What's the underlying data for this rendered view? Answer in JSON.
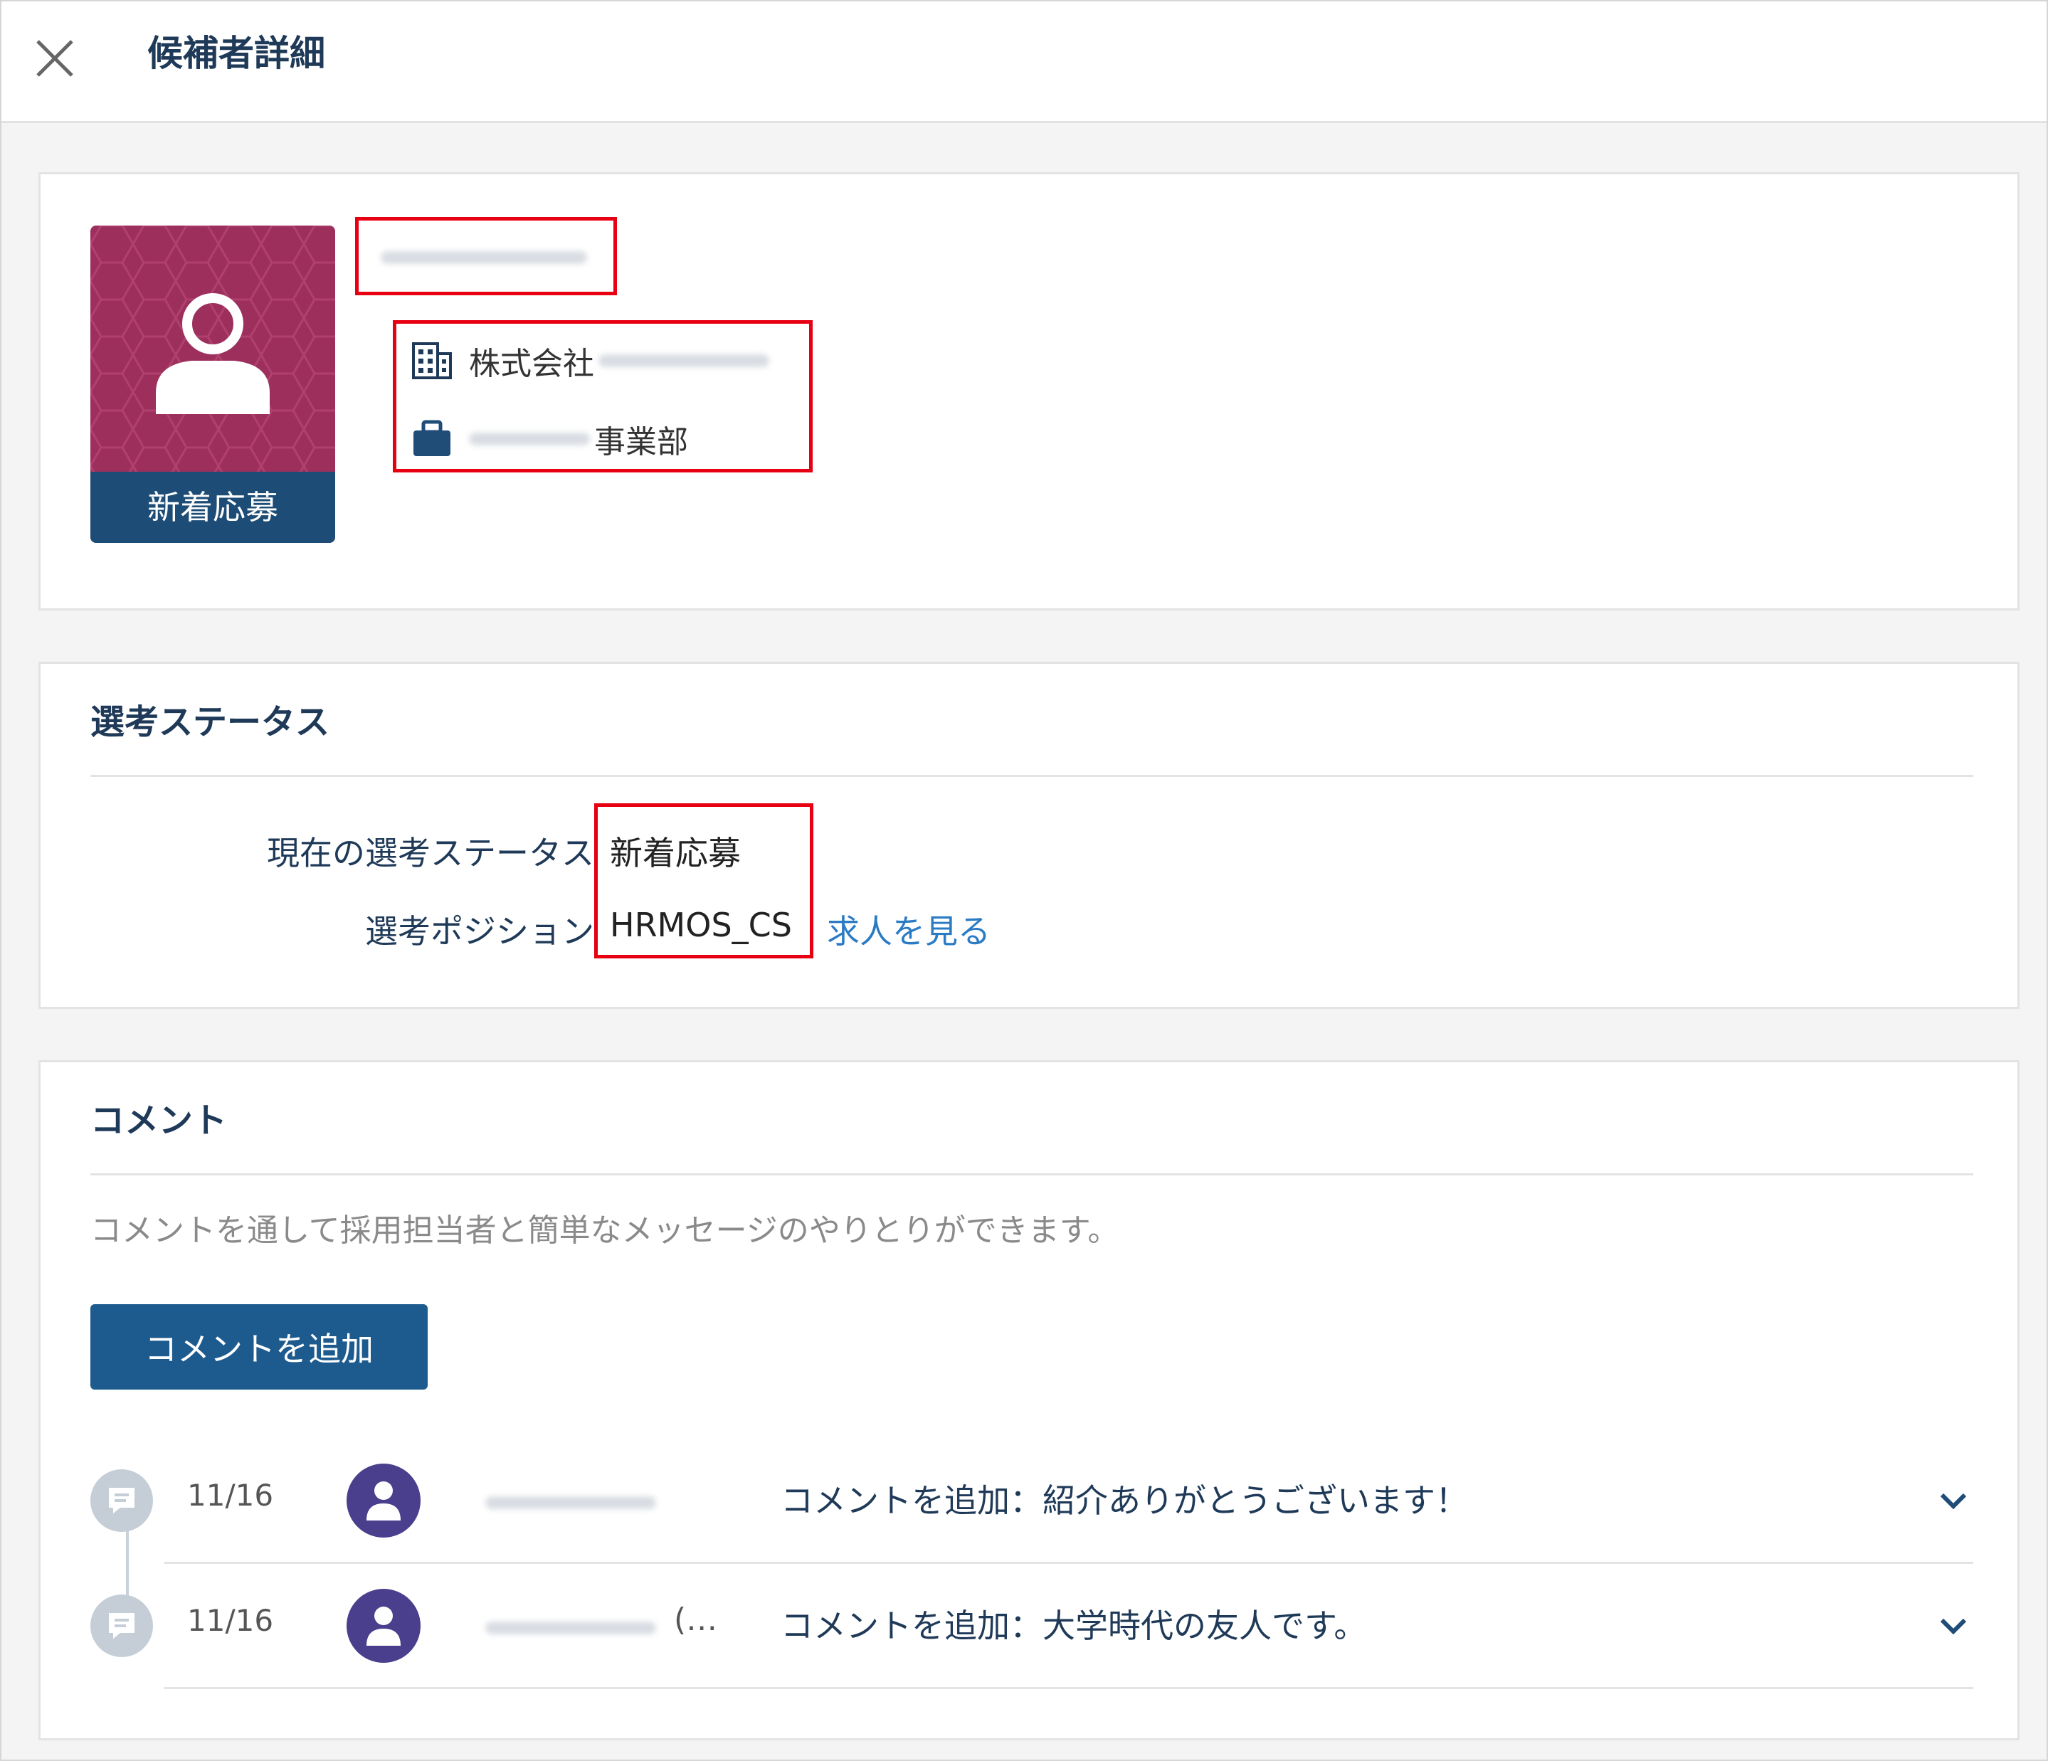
{
  "header": {
    "title": "候補者詳細"
  },
  "profile": {
    "status_label": "新着応募",
    "company_text": "株式会社",
    "department_text": "事業部"
  },
  "status_section": {
    "title": "選考ステータス",
    "current_status_label": "現在の選考ステータス",
    "current_status_value": "新着応募",
    "position_label": "選考ポジション",
    "position_value": "HRMOS_CS",
    "job_link": "求人を見る"
  },
  "comments_section": {
    "title": "コメント",
    "description": "コメントを通して採用担当者と簡単なメッセージのやりとりができます。",
    "add_button": "コメントを追加",
    "items": [
      {
        "date": "11/16",
        "text": "コメントを追加：紹介ありがとうございます！",
        "suffix": ""
      },
      {
        "date": "11/16",
        "text": "コメントを追加：大学時代の友人です。",
        "suffix": "(…"
      }
    ]
  },
  "colors": {
    "brand_navy": "#1d4d76",
    "avatar_bg": "#9c2f5c",
    "highlight_red": "#e60012",
    "link_blue": "#2b7bc4",
    "user_avatar": "#4a3f8c"
  }
}
